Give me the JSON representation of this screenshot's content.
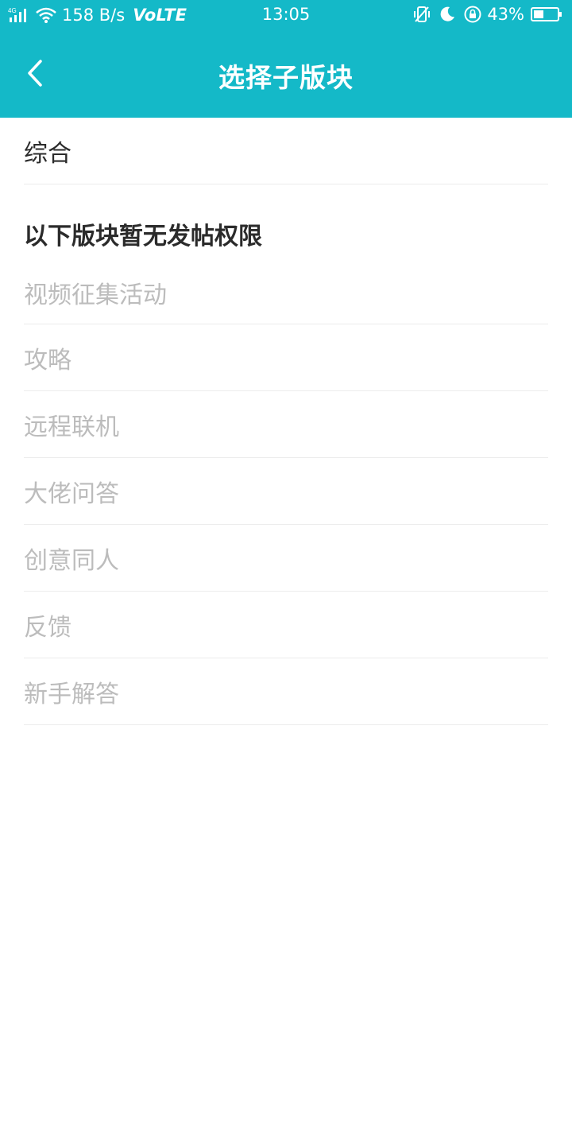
{
  "status_bar": {
    "network_type": "4G",
    "speed": "158 B/s",
    "volte": "VoLTE",
    "time": "13:05",
    "battery_percent": "43%",
    "battery_level": 0.43
  },
  "header": {
    "title": "选择子版块",
    "background": "#14b9c8"
  },
  "top_item": {
    "label": "综合"
  },
  "section": {
    "title": "以下版块暂无发帖权限"
  },
  "disabled_items": [
    {
      "label": "视频征集活动"
    },
    {
      "label": "攻略"
    },
    {
      "label": "远程联机"
    },
    {
      "label": "大佬问答"
    },
    {
      "label": "创意同人"
    },
    {
      "label": "反馈"
    },
    {
      "label": "新手解答"
    }
  ]
}
